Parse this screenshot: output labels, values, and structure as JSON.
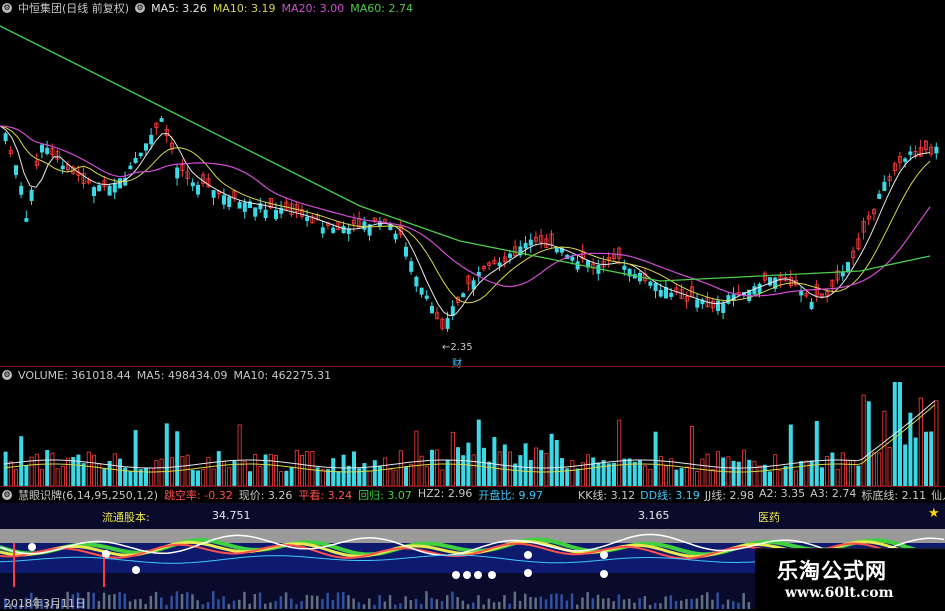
{
  "colors": {
    "up": "#ff3c3c",
    "down": "#3cd8e6",
    "ma5": "#e8e8e8",
    "ma10": "#d8d84a",
    "ma20": "#d34cd3",
    "ma60": "#4ccc4c",
    "divider": "#8a1010",
    "label_gray": "#c8c8c8",
    "label_red": "#ff5050",
    "label_green": "#40d040",
    "label_cyan": "#40c8ff",
    "label_yellow": "#e8e850"
  },
  "price_panel": {
    "settings_icon": "gear-icon",
    "title": "中恒集团(日线 前复权)",
    "ma5": "MA5: 3.26",
    "ma10": "MA10: 3.19",
    "ma20": "MA20: 3.00",
    "ma60": "MA60: 2.74",
    "low_marker": "←2.35",
    "low_marker_value": 2.35,
    "event_marker": "财"
  },
  "volume_panel": {
    "settings_icon": "gear-icon",
    "volume": "VOLUME: 361018.44",
    "ma5": "MA5: 498434.09",
    "ma10": "MA10: 462275.31"
  },
  "indicator_panel": {
    "settings_icon": "gear-icon",
    "name": "慧眼识牌(6,14,95,250,1,2)",
    "items": [
      {
        "text": "跳空率: -0.32",
        "color": "label_red"
      },
      {
        "text": "现价: 3.26",
        "color": "label_gray"
      },
      {
        "text": "平看: 3.24",
        "color": "label_red"
      },
      {
        "text": "回归: 3.07",
        "color": "label_green"
      },
      {
        "text": "HZ2: 2.96",
        "color": "label_gray"
      },
      {
        "text": "开盘比: 9.97",
        "color": "label_cyan"
      }
    ],
    "right_items": [
      {
        "text": "KK线: 3.12",
        "color": "label_gray"
      },
      {
        "text": "DD线: 3.19",
        "color": "label_cyan"
      },
      {
        "text": "JJ线: 2.98",
        "color": "label_gray"
      },
      {
        "text": "A2: 3.35",
        "color": "label_gray"
      },
      {
        "text": "A3: 2.74",
        "color": "label_gray"
      },
      {
        "text": "标底线: 2.11",
        "color": "label_gray"
      },
      {
        "text": "仙人路:",
        "color": "label_gray"
      }
    ],
    "float_label": "流通股本:",
    "float_value": "34.751",
    "mid_value": "3.165",
    "industry": "医药",
    "date": "2018年3月11日",
    "star_icon": "star-icon"
  },
  "watermark": {
    "title": "乐淘公式网",
    "url": "www.60lt.com"
  }
}
